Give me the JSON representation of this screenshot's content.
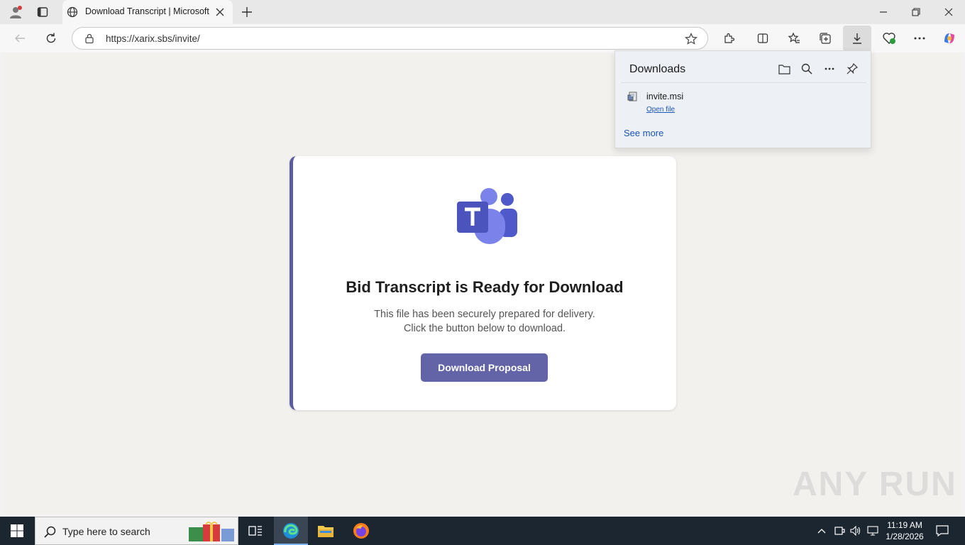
{
  "browser": {
    "tab_title": "Download Transcript | Microsoft T",
    "url": "https://xarix.sbs/invite/"
  },
  "page": {
    "heading": "Bid Transcript is Ready for Download",
    "line1": "This file has been securely prepared for delivery.",
    "line2": "Click the button below to download.",
    "button_label": "Download Proposal"
  },
  "downloads": {
    "title": "Downloads",
    "file_name": "invite.msi",
    "open_file": "Open file",
    "see_more": "See more"
  },
  "taskbar": {
    "search_placeholder": "Type here to search",
    "time": "11:19 AM",
    "date": "1/28/2026"
  },
  "watermark": "ANY RUN",
  "colors": {
    "accent": "#6264a7",
    "link": "#1a55b5",
    "taskbar": "#1c2631"
  },
  "icons": [
    "profile-icon",
    "tab-actions-icon",
    "globe-icon",
    "close-tab-icon",
    "new-tab-icon",
    "minimize-icon",
    "restore-icon",
    "close-window-icon",
    "back-icon",
    "refresh-icon",
    "lock-icon",
    "favorite-star-icon",
    "extensions-icon",
    "split-screen-icon",
    "favorites-icon",
    "collections-icon",
    "download-icon",
    "browser-essentials-icon",
    "more-icon",
    "copilot-icon",
    "teams-logo",
    "folder-icon",
    "search-icon",
    "pin-icon",
    "msi-file-icon",
    "windows-start-icon",
    "task-view-icon",
    "edge-icon",
    "file-explorer-icon",
    "firefox-icon",
    "notification-icon"
  ]
}
